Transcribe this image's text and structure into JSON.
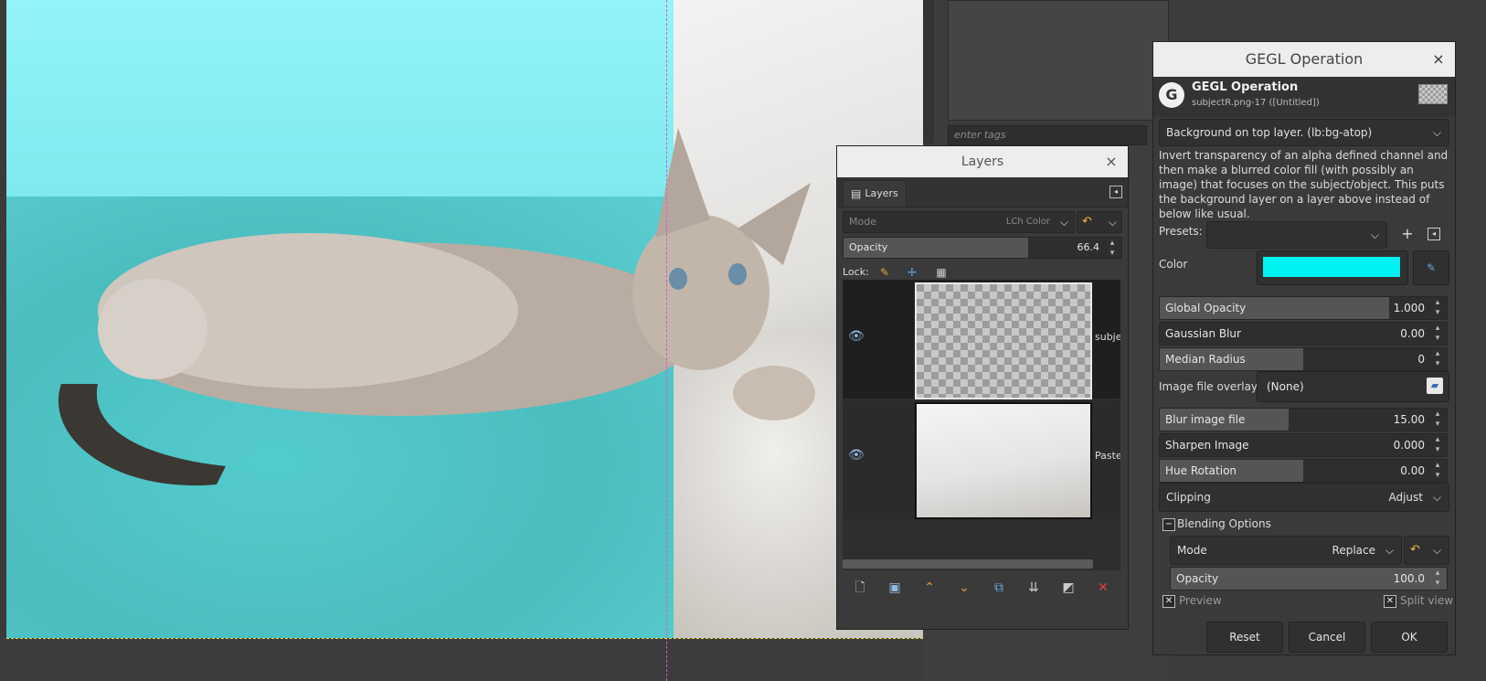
{
  "canvas": {
    "description_free": true
  },
  "dock": {
    "tags_placeholder": "enter tags"
  },
  "layers_window": {
    "title": "Layers",
    "close_glyph": "×",
    "tab_label": "Layers",
    "mode_label": "Mode",
    "mode_value": "LCh Color",
    "opacity_label": "Opacity",
    "opacity_value": "66.4",
    "opacity_fraction": 0.664,
    "lock_label": "Lock:",
    "layers": [
      {
        "name": "subjec"
      },
      {
        "name": "Pastec"
      }
    ]
  },
  "gegl": {
    "window_title": "GEGL Operation",
    "header_title": "GEGL Operation",
    "header_subtitle": "subjectR.png-17 ([Untitled])",
    "operation": "Background on top layer. (lb:bg-atop)",
    "description": "Invert transparency of an alpha defined channel and then make a blurred color fill (with possibly an image) that focuses on the subject/object. This puts the background layer on a layer above instead of below like usual.",
    "presets_label": "Presets:",
    "color_label": "Color",
    "color_value": "#00f2f2",
    "sliders": [
      {
        "label": "Global Opacity",
        "value": "1.000",
        "fraction": 0.8
      },
      {
        "label": "Gaussian Blur",
        "value": "0.00",
        "fraction": 0.0
      },
      {
        "label": "Median Radius",
        "value": "0",
        "fraction": 0.5
      }
    ],
    "image_overlay_label": "Image file overlay",
    "image_overlay_value": "(None)",
    "sliders2": [
      {
        "label": "Blur image file",
        "value": "15.00",
        "fraction": 0.45
      },
      {
        "label": "Sharpen Image",
        "value": "0.000",
        "fraction": 0.0
      },
      {
        "label": "Hue Rotation",
        "value": "0.00",
        "fraction": 0.5
      }
    ],
    "clipping_label": "Clipping",
    "clipping_value": "Adjust",
    "blending_label": "Blending Options",
    "blend_mode_label": "Mode",
    "blend_mode_value": "Replace",
    "blend_opacity_label": "Opacity",
    "blend_opacity_value": "100.0",
    "preview_label": "Preview",
    "split_view_label": "Split view",
    "reset_label": "Reset",
    "cancel_label": "Cancel",
    "ok_label": "OK"
  }
}
